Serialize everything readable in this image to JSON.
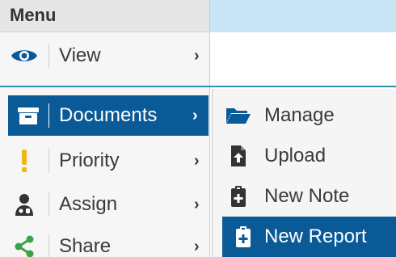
{
  "menu": {
    "title": "Menu",
    "items": [
      {
        "label": "View",
        "icon": "eye-icon",
        "chevron": "›"
      },
      {
        "label": "Documents",
        "icon": "archive-box-icon",
        "chevron": "›",
        "active": true
      },
      {
        "label": "Priority",
        "icon": "exclamation-icon",
        "chevron": "›"
      },
      {
        "label": "Assign",
        "icon": "doctor-icon",
        "chevron": "›"
      },
      {
        "label": "Share",
        "icon": "share-icon",
        "chevron": "›"
      }
    ]
  },
  "submenu": {
    "items": [
      {
        "label": "Manage",
        "icon": "folder-open-icon"
      },
      {
        "label": "Upload",
        "icon": "file-upload-icon"
      },
      {
        "label": "New Note",
        "icon": "clipboard-plus-icon"
      },
      {
        "label": "New Report",
        "icon": "clipboard-plus-icon",
        "active": true
      }
    ]
  },
  "colors": {
    "accent": "#0b5a98",
    "topbar": "#c8e5f5",
    "priority": "#f2b51b",
    "share": "#3aa34a",
    "divider": "#2f8fb0"
  }
}
